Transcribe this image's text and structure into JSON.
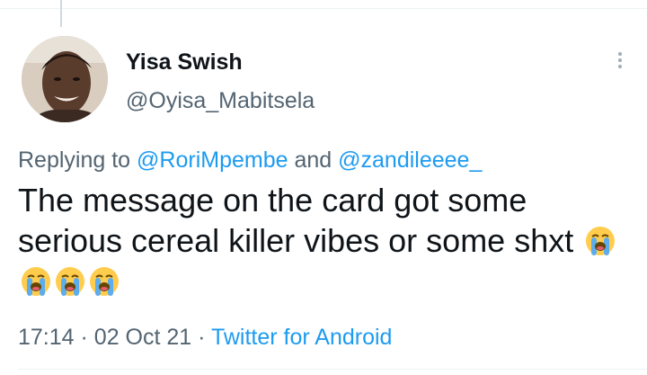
{
  "tweet": {
    "display_name": "Yisa Swish",
    "handle": "@Oyisa_Mabitsela",
    "reply": {
      "prefix": "Replying to",
      "mention_1": "@RoriMpembe",
      "conjunction": "and",
      "mention_2": "@zandileeee_"
    },
    "text": "The message on the card got some serious cereal killer vibes or some shxt",
    "emojis": [
      "loudly-crying-face-icon",
      "loudly-crying-face-icon",
      "loudly-crying-face-icon",
      "loudly-crying-face-icon"
    ],
    "time": "17:14",
    "date": "02 Oct 21",
    "source": "Twitter for Android",
    "separator": "·"
  },
  "colors": {
    "text": "#0f1419",
    "secondary": "#536471",
    "link": "#1d9bf0",
    "border": "#eff3f4"
  }
}
